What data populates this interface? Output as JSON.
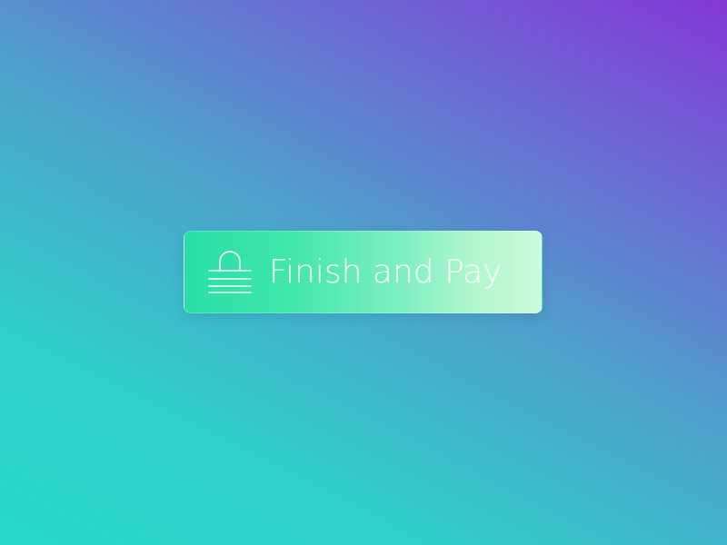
{
  "button": {
    "label": "Finish and Pay",
    "icon": "lock-icon"
  },
  "colors": {
    "background_start": "#26d8c8",
    "background_end": "#8437d6",
    "button_start": "#28dfa8",
    "button_end": "#cdfadc",
    "text": "#ffffff"
  }
}
